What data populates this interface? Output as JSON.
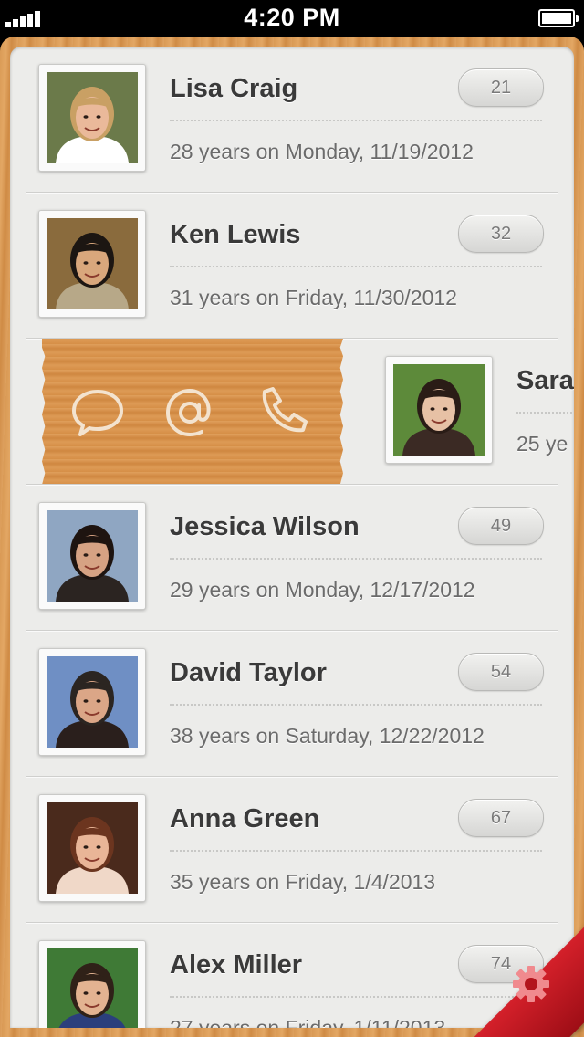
{
  "status_bar": {
    "time": "4:20 PM"
  },
  "contacts": [
    {
      "name": "Lisa Craig",
      "subtitle": "28 years on Monday, 11/19/2012",
      "count": "21",
      "avatar": {
        "bg": "#6b7a4a",
        "skin": "#eab99a",
        "hair": "#c9a064",
        "shirt": "#ffffff"
      }
    },
    {
      "name": "Ken Lewis",
      "subtitle": "31 years on Friday, 11/30/2012",
      "count": "32",
      "avatar": {
        "bg": "#8a6b3d",
        "skin": "#d9a77c",
        "hair": "#1c1612",
        "shirt": "#b7a888"
      }
    },
    {
      "name": "Sara",
      "subtitle": "25 ye",
      "count": "",
      "avatar": {
        "bg": "#5d8a3a",
        "skin": "#e7c1a5",
        "hair": "#2a1c16",
        "shirt": "#3b2a24"
      }
    },
    {
      "name": "Jessica Wilson",
      "subtitle": "29 years on Monday, 12/17/2012",
      "count": "49",
      "avatar": {
        "bg": "#8fa6c2",
        "skin": "#d6a283",
        "hair": "#1e1410",
        "shirt": "#2b2421"
      }
    },
    {
      "name": "David Taylor",
      "subtitle": "38 years on Saturday, 12/22/2012",
      "count": "54",
      "avatar": {
        "bg": "#6f8fc4",
        "skin": "#dba687",
        "hair": "#2b2521",
        "shirt": "#2a1f1c"
      }
    },
    {
      "name": "Anna Green",
      "subtitle": "35 years on Friday, 1/4/2013",
      "count": "67",
      "avatar": {
        "bg": "#4a2a1c",
        "skin": "#e9b597",
        "hair": "#6c351f",
        "shirt": "#f0d8c8"
      }
    },
    {
      "name": "Alex Miller",
      "subtitle": "27 years on Friday, 1/11/2013",
      "count": "74",
      "avatar": {
        "bg": "#3f7a36",
        "skin": "#e3b391",
        "hair": "#2f2118",
        "shirt": "#2b3f7c"
      }
    }
  ],
  "swipe_actions": [
    {
      "icon": "chat-bubble-icon"
    },
    {
      "icon": "at-sign-icon"
    },
    {
      "icon": "phone-icon"
    }
  ],
  "colors": {
    "wood": "#d99a55",
    "ribbon": "#c41a24",
    "panel": "#ececea"
  }
}
